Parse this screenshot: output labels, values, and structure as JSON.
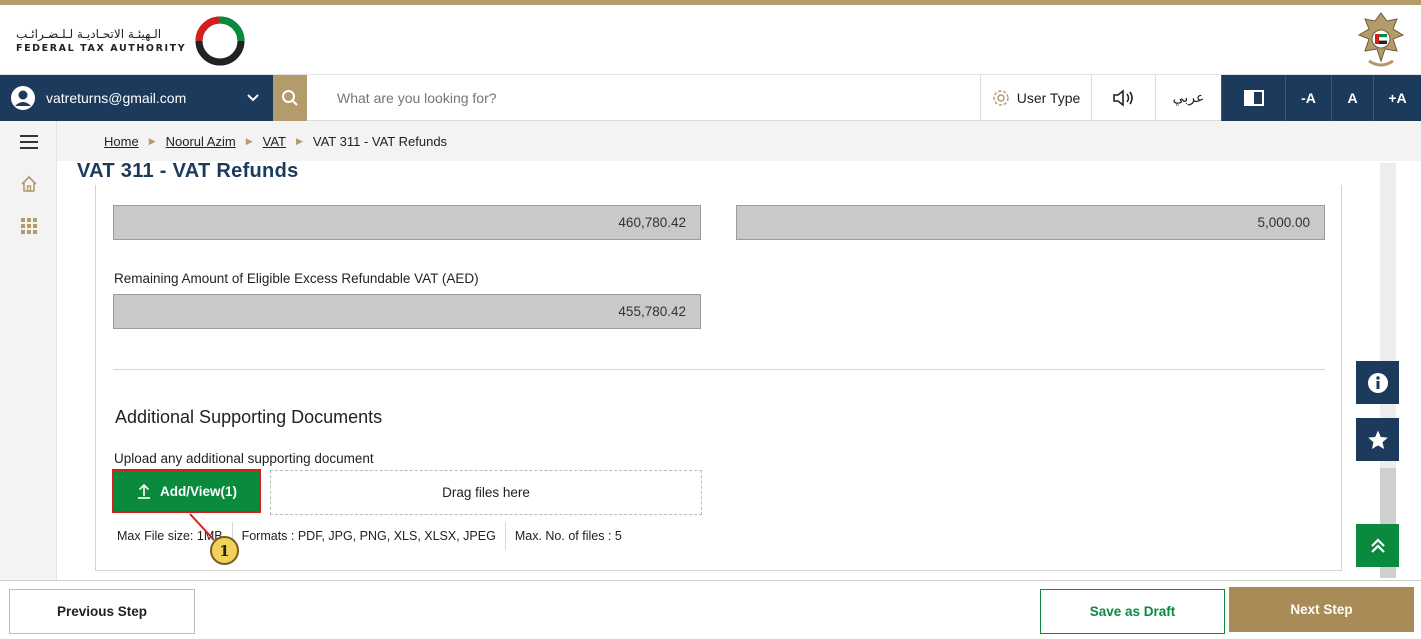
{
  "colors": {
    "brand_navy": "#1b3a5c",
    "brand_gold": "#b39b6b",
    "action_green": "#0a8a3d",
    "highlight_red": "#d31f1f",
    "readonly_field": "#c9c9c9"
  },
  "header": {
    "logo_ar": "الـهيئـة الاتحـاديـة لـلـضـرائـب",
    "logo_en": "FEDERAL TAX AUTHORITY",
    "emblem_icon": "uae-emblem-icon"
  },
  "navbar": {
    "account_email": "vatreturns@gmail.com",
    "account_icon": "user-circle-icon",
    "search_placeholder": "What are you looking for?",
    "user_type_label": "User Type",
    "arabic_label": "عربي",
    "font_decrease": "-A",
    "font_reset": "A",
    "font_increase": "+A"
  },
  "sidebar": {
    "items": [
      {
        "icon": "hamburger-menu-icon"
      },
      {
        "icon": "home-icon"
      },
      {
        "icon": "grid-apps-icon"
      }
    ]
  },
  "breadcrumb": {
    "items": [
      "Home",
      "Noorul Azim",
      "VAT"
    ],
    "current": "VAT 311 - VAT Refunds"
  },
  "page": {
    "title": "VAT 311 - VAT Refunds"
  },
  "form": {
    "field_left_value": "460,780.42",
    "field_right_value": "5,000.00",
    "remaining_label": "Remaining Amount of Eligible Excess Refundable VAT (AED)",
    "remaining_value": "455,780.42"
  },
  "documents": {
    "section_title": "Additional Supporting Documents",
    "upload_label": "Upload any additional supporting document",
    "add_view_label": "Add/View(1)",
    "dropzone_label": "Drag files here",
    "max_file_size": "Max File size: 1MB",
    "formats": "Formats : PDF, JPG, PNG, XLS, XLSX, JPEG",
    "max_files": "Max. No. of files : 5"
  },
  "callout": {
    "number": "1"
  },
  "floating": {
    "info_icon": "info-icon",
    "star_icon": "star-icon",
    "top_icon": "double-chevron-up-icon"
  },
  "footer": {
    "previous_label": "Previous Step",
    "draft_label": "Save as Draft",
    "next_label": "Next Step"
  }
}
